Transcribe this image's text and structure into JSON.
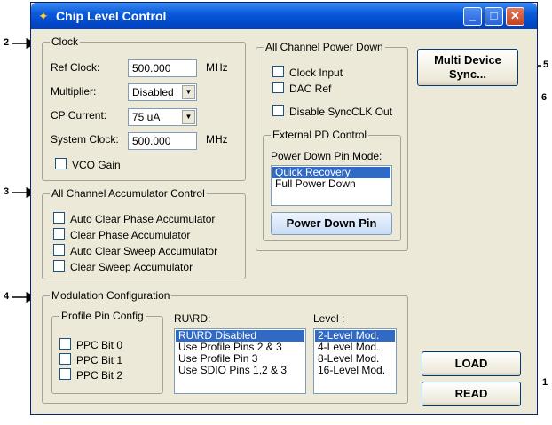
{
  "window": {
    "title": "Chip Level Control"
  },
  "titlebar": {
    "minimize": "_",
    "maximize": "□",
    "close": "✕"
  },
  "clock": {
    "legend": "Clock",
    "ref_clock_label": "Ref Clock:",
    "ref_clock_value": "500.000",
    "ref_clock_unit": "MHz",
    "multiplier_label": "Multiplier:",
    "multiplier_value": "Disabled",
    "cp_current_label": "CP Current:",
    "cp_current_value": "75 uA",
    "system_clock_label": "System Clock:",
    "system_clock_value": "500.000",
    "system_clock_unit": "MHz",
    "vco_gain_label": "VCO Gain"
  },
  "accumulator": {
    "legend": "All Channel Accumulator Control",
    "items": [
      "Auto Clear Phase Accumulator",
      "Clear Phase Accumulator",
      "Auto Clear Sweep Accumulator",
      "Clear Sweep Accumulator"
    ]
  },
  "power_down": {
    "legend": "All Channel Power Down",
    "clock_input": "Clock Input",
    "dac_ref": "DAC Ref",
    "disable_syncclk": "Disable SyncCLK Out",
    "external": {
      "legend": "External PD Control",
      "mode_label": "Power Down Pin Mode:",
      "modes": [
        "Quick Recovery",
        "Full Power Down"
      ],
      "button": "Power Down Pin"
    }
  },
  "multi_device": {
    "label_line1": "Multi Device",
    "label_line2": "Sync..."
  },
  "modulation": {
    "legend": "Modulation Configuration",
    "profile_legend": "Profile Pin Config",
    "ppc": [
      "PPC Bit 0",
      "PPC Bit 1",
      "PPC Bit 2"
    ],
    "ru_rd_label": "RU\\RD:",
    "ru_rd_options": [
      "RU\\RD Disabled",
      "Use Profile Pins 2 & 3",
      "Use Profile Pin 3",
      "Use SDIO Pins 1,2 & 3"
    ],
    "level_label": "Level :",
    "level_options": [
      "2-Level Mod.",
      "4-Level Mod.",
      "8-Level Mod.",
      "16-Level Mod."
    ]
  },
  "buttons": {
    "load": "LOAD",
    "read": "READ"
  },
  "callouts": {
    "c1": "1",
    "c2": "2",
    "c3": "3",
    "c4": "4",
    "c5": "5",
    "c6": "6"
  }
}
